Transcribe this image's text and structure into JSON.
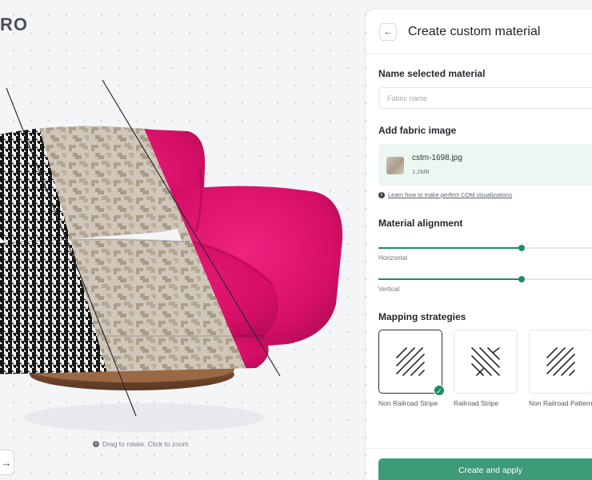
{
  "viewer": {
    "brand_text": "RO",
    "hint_text": "Drag to rotate. Click to zoom",
    "hint_icon": "info-icon",
    "nav_icon": "arrow-right-icon",
    "nav_glyph": "→"
  },
  "panel": {
    "back_icon": "arrow-left-icon",
    "back_glyph": "←",
    "title": "Create custom material",
    "name_section": {
      "label": "Name selected material",
      "placeholder": "Fabric name",
      "value": ""
    },
    "image_section": {
      "label": "Add fabric image",
      "file_name": "cstm-1698.jpg",
      "file_size": "1,2MB",
      "help_link": "Learn how to make perfect COM visualizations",
      "help_icon": "info-icon"
    },
    "alignment_section": {
      "label": "Material alignment",
      "horizontal": {
        "label": "Horizontal",
        "value": 0.65
      },
      "vertical": {
        "label": "Vertical",
        "value": 0.65
      }
    },
    "mapping_section": {
      "label": "Mapping strategies",
      "options": [
        {
          "label": "Non Railroad Stripe",
          "selected": true,
          "icon": "diagonal-stripes-icon"
        },
        {
          "label": "Railroad Stripe",
          "selected": false,
          "icon": "cross-stripes-icon"
        },
        {
          "label": "Non Railroad Pattern",
          "selected": false,
          "icon": "diagonal-stripes-icon"
        }
      ],
      "check_glyph": "✓"
    },
    "primary_button": "Create and apply"
  },
  "colors": {
    "accent": "#1f8d5f",
    "button": "#3d9b78",
    "upload_bg": "#edf6f1",
    "fabric_pink": "#e0146f"
  }
}
